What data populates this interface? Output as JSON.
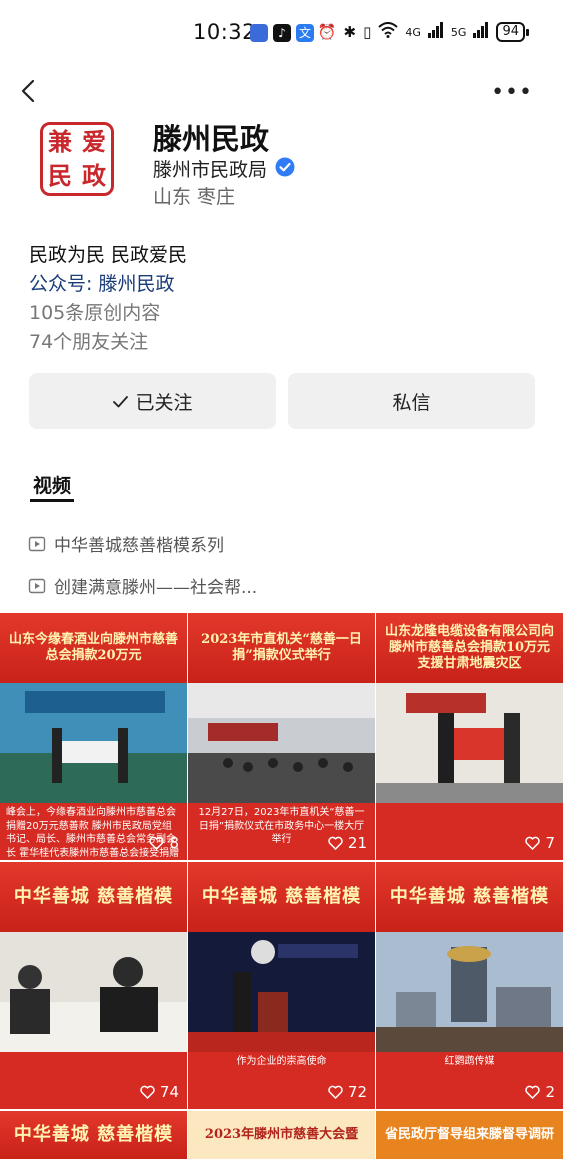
{
  "status_bar": {
    "time": "10:32",
    "tiktok_glyph": "♪",
    "translate_glyph": "文",
    "network_1": "4G",
    "network_2": "5G",
    "battery": "94"
  },
  "profile": {
    "logo_chars": [
      "兼",
      "爱",
      "民",
      "政"
    ],
    "account_name": "滕州民政",
    "org_name": "滕州市民政局",
    "location": "山东 枣庄",
    "bio": "民政为民 民政爱民",
    "public_id": "公众号: 滕州民政",
    "original_count": "105条原创内容",
    "friends_following": "74个朋友关注"
  },
  "actions": {
    "follow_label": "已关注",
    "message_label": "私信"
  },
  "tabs": {
    "video": "视频"
  },
  "playlists": [
    {
      "title": "中华善城慈善楷模系列"
    },
    {
      "title": "创建满意滕州——社会帮..."
    }
  ],
  "videos": [
    {
      "banner": "山东今缘春酒业向滕州市慈善总会捐款20万元",
      "caption": "峰会上，今缘春酒业向滕州市慈善总会捐赠20万元慈善款 滕州市民政局党组书记、局长、滕州市慈善总会常务副会长 霍华桂代表滕州市慈善总会接受捐赠",
      "likes": "8"
    },
    {
      "banner": "2023年市直机关“慈善一日捐”捐款仪式举行",
      "caption": "12月27日，2023年市直机关“慈善一日捐”捐款仪式在市政务中心一楼大厅举行",
      "likes": "21"
    },
    {
      "banner": "山东龙隆电缆设备有限公司向滕州市慈善总会捐款10万元支援甘肃地震灾区",
      "caption": "",
      "likes": "7"
    },
    {
      "banner": "中华善城 慈善楷模",
      "caption": "",
      "likes": "74"
    },
    {
      "banner": "中华善城 慈善楷模",
      "caption": "作为企业的崇高使命",
      "likes": "72"
    },
    {
      "banner": "中华善城 慈善楷模",
      "caption": "红鹦鹉传媒",
      "likes": "2"
    },
    {
      "banner": "中华善城 慈善楷模",
      "caption": "",
      "likes": ""
    },
    {
      "banner": "2023年滕州市慈善大会暨",
      "caption": "",
      "likes": ""
    },
    {
      "banner": "省民政厅督导组来滕督导调研",
      "caption": "",
      "likes": ""
    }
  ],
  "colors": {
    "accent_red": "#d62b22",
    "link_blue": "#1a3d7a",
    "verified_blue": "#2f7cf6"
  }
}
